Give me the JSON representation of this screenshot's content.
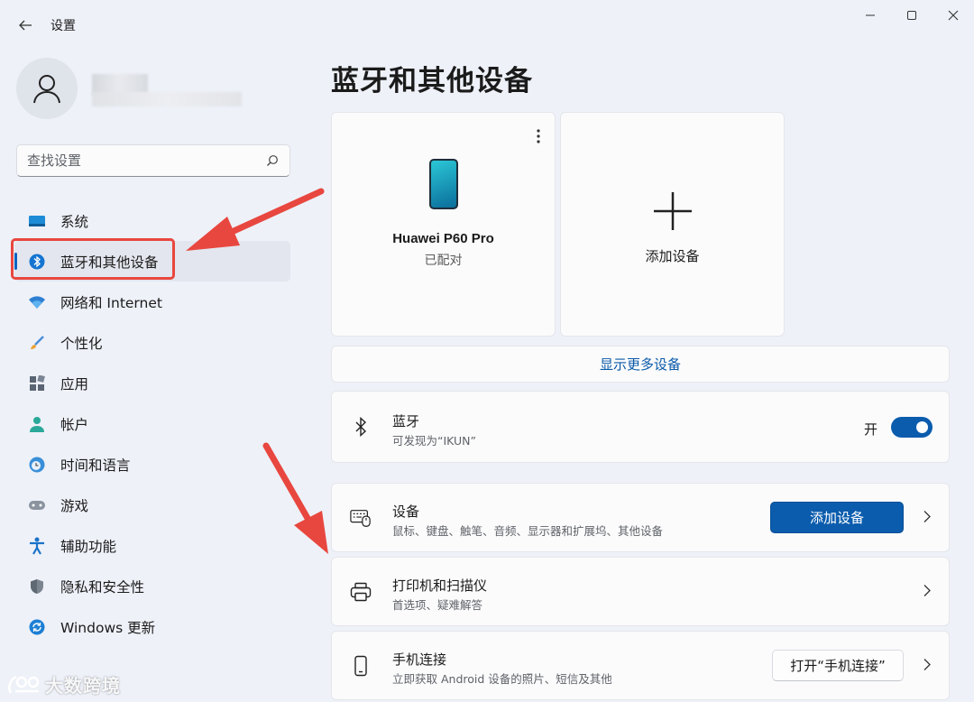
{
  "app": {
    "title": "设置"
  },
  "search": {
    "placeholder": "查找设置"
  },
  "sidebar": {
    "items": [
      {
        "label": "系统",
        "icon": "system-icon"
      },
      {
        "label": "蓝牙和其他设备",
        "icon": "bluetooth-icon",
        "active": true
      },
      {
        "label": "网络和 Internet",
        "icon": "wifi-icon"
      },
      {
        "label": "个性化",
        "icon": "brush-icon"
      },
      {
        "label": "应用",
        "icon": "apps-icon"
      },
      {
        "label": "帐户",
        "icon": "account-icon"
      },
      {
        "label": "时间和语言",
        "icon": "clock-globe-icon"
      },
      {
        "label": "游戏",
        "icon": "gamepad-icon"
      },
      {
        "label": "辅助功能",
        "icon": "accessibility-icon"
      },
      {
        "label": "隐私和安全性",
        "icon": "shield-icon"
      },
      {
        "label": "Windows 更新",
        "icon": "update-icon"
      }
    ]
  },
  "main": {
    "title": "蓝牙和其他设备",
    "device": {
      "name": "Huawei P60 Pro",
      "status": "已配对"
    },
    "add_device_card": {
      "label": "添加设备"
    },
    "show_more": "显示更多设备",
    "bluetooth": {
      "title": "蓝牙",
      "subtitle": "可发现为“IKUN”",
      "toggle_label": "开",
      "enabled": true
    },
    "devices_row": {
      "title": "设备",
      "subtitle": "鼠标、键盘、触笔、音频、显示器和扩展坞、其他设备",
      "button": "添加设备"
    },
    "printers_row": {
      "title": "打印机和扫描仪",
      "subtitle": "首选项、疑难解答"
    },
    "phone_row": {
      "title": "手机连接",
      "subtitle": "立即获取 Android 设备的照片、短信及其他",
      "button": "打开“手机连接”"
    }
  },
  "watermark": {
    "text": "大数跨境"
  },
  "colors": {
    "accent": "#0b5cad",
    "annotation": "#e8473f",
    "background": "#eef1f8"
  }
}
